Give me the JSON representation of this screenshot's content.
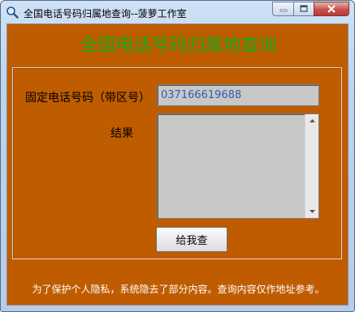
{
  "window": {
    "title": "全国电话号码归属地查询--菠萝工作室"
  },
  "heading": "全国电话号码归属地查询",
  "form": {
    "phone_label": "固定电话号码（带区号）",
    "phone_value": "037166619688",
    "result_label": "结果",
    "result_value": "",
    "query_button": "给我查"
  },
  "notice": "为了保护个人隐私，系统隐去了部分内容。查询内容仅作地址参考。",
  "colors": {
    "client_background": "#bf5c00",
    "heading": "#18a818",
    "input_background": "#c8c8c8",
    "notice_text": "#ffffff"
  },
  "icons": {
    "app": "magnifier-icon",
    "minimize": "minimize-icon",
    "maximize": "maximize-icon",
    "close": "close-icon"
  }
}
